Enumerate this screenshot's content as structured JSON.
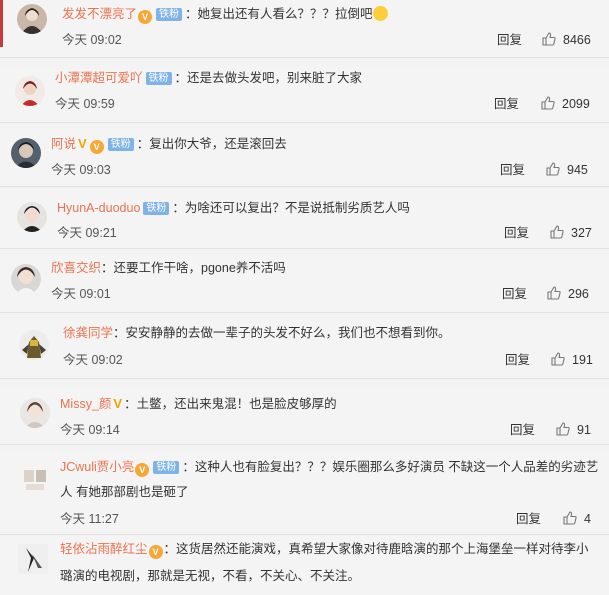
{
  "comments": [
    {
      "user": "发发不漂亮了",
      "badge": "铁粉",
      "text": "：她复出还有人看么？？？拉倒吧",
      "time": "今天 09:02",
      "reply": "回复",
      "likes": "8466"
    },
    {
      "user": "小潭潭超可爱吖",
      "badge": "铁粉",
      "text": "：还是去做头发吧，别来脏了大家",
      "time": "今天 09:59",
      "reply": "回复",
      "likes": "2099"
    },
    {
      "user": "阿说",
      "badge": "铁粉",
      "text": "：复出你大爷，还是滚回去",
      "time": "今天 09:03",
      "reply": "回复",
      "likes": "945"
    },
    {
      "user": "HyunA-duoduo",
      "badge": "铁粉",
      "text": "：为啥还可以复出？不是说抵制劣质艺人吗",
      "time": "今天 09:21",
      "reply": "回复",
      "likes": "327"
    },
    {
      "user": "欣喜交织",
      "text": "：还要工作干啥，pgone养不活吗",
      "time": "今天 09:01",
      "reply": "回复",
      "likes": "296"
    },
    {
      "user": "徐龚同学",
      "text": "：安安静静的去做一辈子的头发不好么，我们也不想看到你。",
      "time": "今天 09:02",
      "reply": "回复",
      "likes": "191"
    },
    {
      "user": "Missy_颜",
      "text": "：土鳖，还出来鬼混！也是脸皮够厚的",
      "time": "今天 09:14",
      "reply": "回复",
      "likes": "91"
    },
    {
      "user": "JCwuli贾小亮",
      "badge": "铁粉",
      "text": "：这种人也有脸复出？？？娱乐圈那么多好演员 不缺这一个人品差的劣迹艺",
      "text2": "人 有她那部剧也是砸了",
      "time": "今天 11:27",
      "reply": "回复",
      "likes": "4"
    },
    {
      "user": "轻依沾雨醉红尘",
      "text": "：这货居然还能演戏，真希望大家像对待鹿晗演的那个上海堡垒一样对待李小",
      "text2": "璐演的电视剧，那就是无视，不看，不关心、不关注。"
    }
  ]
}
